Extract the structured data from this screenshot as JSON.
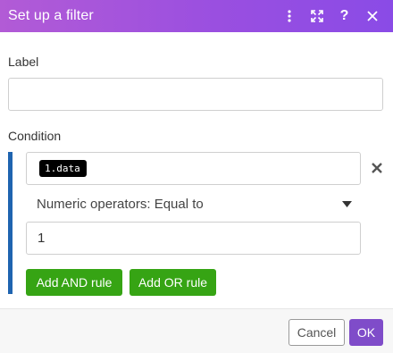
{
  "header": {
    "title": "Set up a filter",
    "icons": [
      "more-vertical-icon",
      "expand-icon",
      "help-icon",
      "close-icon"
    ],
    "help_glyph": "?"
  },
  "label_field": {
    "caption": "Label",
    "value": "",
    "placeholder": ""
  },
  "condition": {
    "caption": "Condition",
    "first_operand": "1.data",
    "operator": "Numeric operators: Equal to",
    "second_operand": "1",
    "add_and_label": "Add AND rule",
    "add_or_label": "Add OR rule"
  },
  "footer": {
    "cancel_label": "Cancel",
    "ok_label": "OK"
  },
  "colors": {
    "header_gradient_start": "#b25bd6",
    "header_gradient_end": "#8a4be6",
    "condition_bar": "#1f64b0",
    "rule_button": "#36a414",
    "ok_button": "#7f4cc9"
  }
}
